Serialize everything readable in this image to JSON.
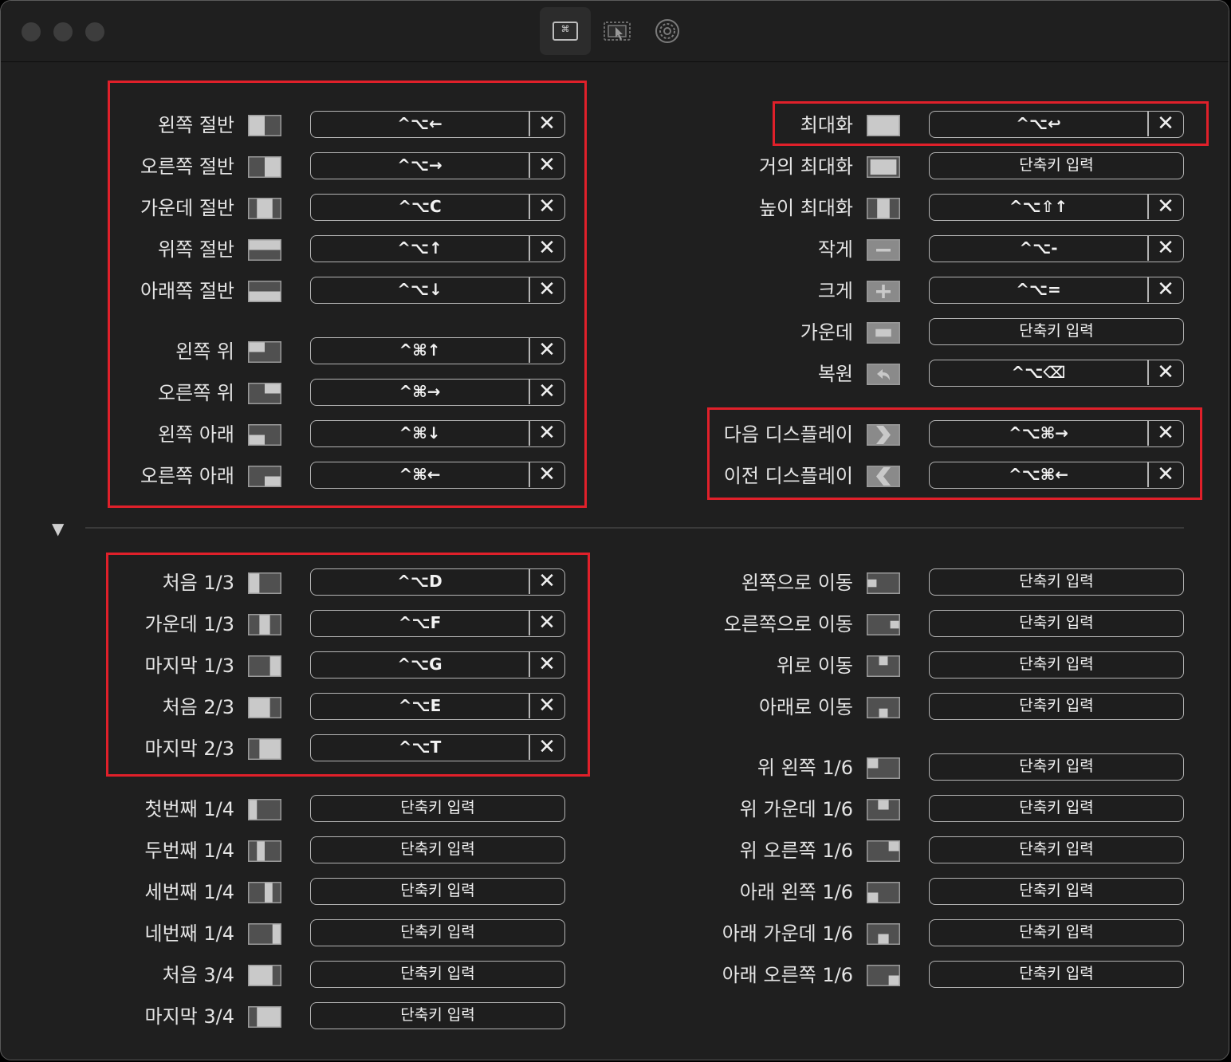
{
  "toolbar": {
    "tabs": [
      {
        "name": "keyboard-shortcuts-tab",
        "icon": "command-key-window-icon",
        "active": true
      },
      {
        "name": "snap-areas-tab",
        "icon": "cursor-window-icon",
        "active": false
      },
      {
        "name": "general-settings-tab",
        "icon": "gear-icon",
        "active": false
      }
    ]
  },
  "placeholder": "단축키 입력",
  "clear_symbol": "✕",
  "disclosure_symbol": "▼",
  "colors": {
    "highlight": "#e0202a",
    "background": "#1f1f1f"
  },
  "left_top": [
    {
      "label": "왼쪽 절반",
      "icon": "left-half",
      "shortcut": "^⌥←"
    },
    {
      "label": "오른쪽 절반",
      "icon": "right-half",
      "shortcut": "^⌥→"
    },
    {
      "label": "가운데 절반",
      "icon": "center-half",
      "shortcut": "^⌥C"
    },
    {
      "label": "위쪽 절반",
      "icon": "top-half",
      "shortcut": "^⌥↑"
    },
    {
      "label": "아래쪽 절반",
      "icon": "bottom-half",
      "shortcut": "^⌥↓"
    },
    {
      "label": "왼쪽 위",
      "icon": "top-left",
      "shortcut": "^⌘↑"
    },
    {
      "label": "오른쪽 위",
      "icon": "top-right",
      "shortcut": "^⌘→"
    },
    {
      "label": "왼쪽 아래",
      "icon": "bottom-left",
      "shortcut": "^⌘↓"
    },
    {
      "label": "오른쪽 아래",
      "icon": "bottom-right",
      "shortcut": "^⌘←"
    }
  ],
  "right_top": [
    {
      "label": "최대화",
      "icon": "maximize",
      "shortcut": "^⌥↩"
    },
    {
      "label": "거의 최대화",
      "icon": "almost-maximize",
      "shortcut": ""
    },
    {
      "label": "높이 최대화",
      "icon": "maximize-height",
      "shortcut": "^⌥⇧↑"
    },
    {
      "label": "작게",
      "icon": "smaller",
      "shortcut": "^⌥-"
    },
    {
      "label": "크게",
      "icon": "larger",
      "shortcut": "^⌥="
    },
    {
      "label": "가운데",
      "icon": "center",
      "shortcut": ""
    },
    {
      "label": "복원",
      "icon": "restore",
      "shortcut": "^⌥⌫"
    },
    {
      "label": "다음 디스플레이",
      "icon": "next-display",
      "shortcut": "^⌥⌘→"
    },
    {
      "label": "이전 디스플레이",
      "icon": "previous-display",
      "shortcut": "^⌥⌘←"
    }
  ],
  "left_bottom": [
    {
      "label": "처음 1/3",
      "icon": "first-third",
      "shortcut": "^⌥D"
    },
    {
      "label": "가운데 1/3",
      "icon": "center-third",
      "shortcut": "^⌥F"
    },
    {
      "label": "마지막 1/3",
      "icon": "last-third",
      "shortcut": "^⌥G"
    },
    {
      "label": "처음 2/3",
      "icon": "first-two-thirds",
      "shortcut": "^⌥E"
    },
    {
      "label": "마지막 2/3",
      "icon": "last-two-thirds",
      "shortcut": "^⌥T"
    },
    {
      "label": "첫번째 1/4",
      "icon": "first-fourth",
      "shortcut": ""
    },
    {
      "label": "두번째 1/4",
      "icon": "second-fourth",
      "shortcut": ""
    },
    {
      "label": "세번째 1/4",
      "icon": "third-fourth",
      "shortcut": ""
    },
    {
      "label": "네번째 1/4",
      "icon": "last-fourth",
      "shortcut": ""
    },
    {
      "label": "처음 3/4",
      "icon": "first-three-fourths",
      "shortcut": ""
    },
    {
      "label": "마지막 3/4",
      "icon": "last-three-fourths",
      "shortcut": ""
    }
  ],
  "right_bottom": [
    {
      "label": "왼쪽으로 이동",
      "icon": "move-left",
      "shortcut": ""
    },
    {
      "label": "오른쪽으로 이동",
      "icon": "move-right",
      "shortcut": ""
    },
    {
      "label": "위로 이동",
      "icon": "move-up",
      "shortcut": ""
    },
    {
      "label": "아래로 이동",
      "icon": "move-down",
      "shortcut": ""
    },
    {
      "label": "위 왼쪽 1/6",
      "icon": "top-left-sixth",
      "shortcut": ""
    },
    {
      "label": "위 가운데 1/6",
      "icon": "top-center-sixth",
      "shortcut": ""
    },
    {
      "label": "위 오른쪽 1/6",
      "icon": "top-right-sixth",
      "shortcut": ""
    },
    {
      "label": "아래 왼쪽 1/6",
      "icon": "bottom-left-sixth",
      "shortcut": ""
    },
    {
      "label": "아래 가운데 1/6",
      "icon": "bottom-center-sixth",
      "shortcut": ""
    },
    {
      "label": "아래 오른쪽 1/6",
      "icon": "bottom-right-sixth",
      "shortcut": ""
    }
  ]
}
